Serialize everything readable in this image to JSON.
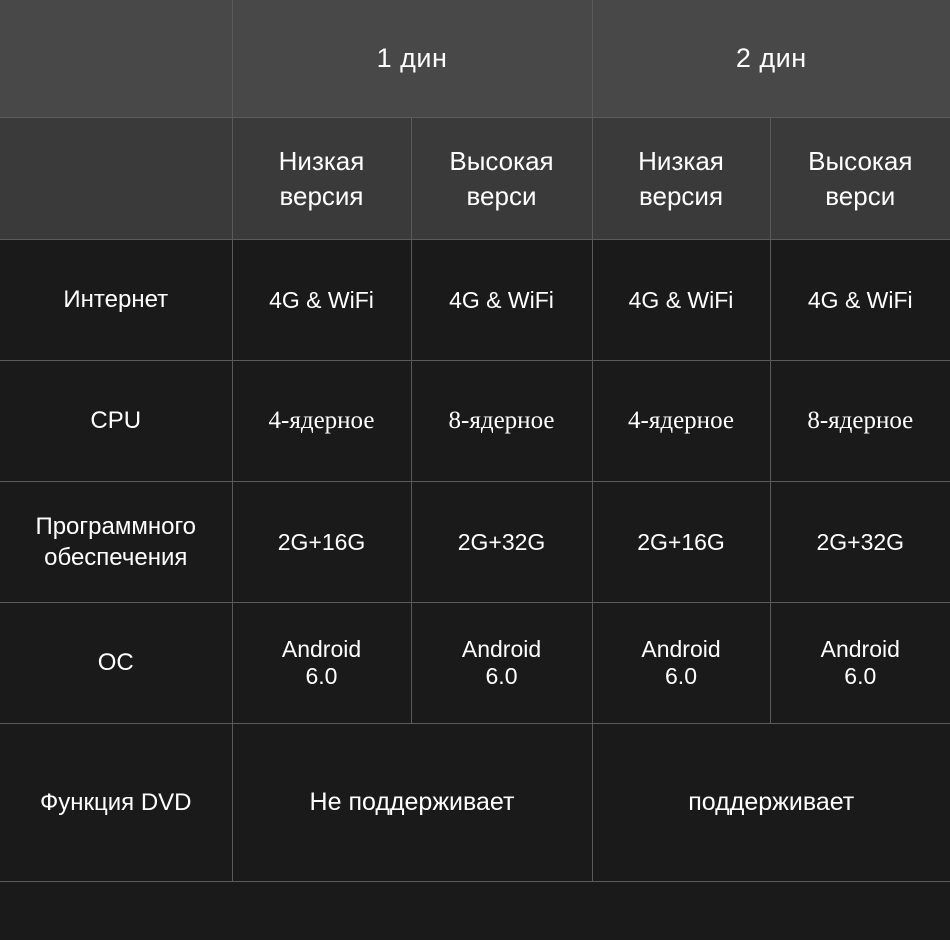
{
  "theme": {
    "background": "#1a1a1a",
    "header_group_bg": "#484848",
    "header_version_bg": "#3a3a3a",
    "grid_line": "#5a5a5a",
    "text": "#ffffff",
    "highlight": "#eec32c"
  },
  "table": {
    "corner_label": "",
    "groups": [
      {
        "label": "1 дин",
        "span": 2
      },
      {
        "label": "2 дин",
        "span": 2
      }
    ],
    "versions": [
      {
        "label": "Низкая версия",
        "line1": "Низкая",
        "line2": "версия",
        "highlight": false
      },
      {
        "label": "Высокая верси",
        "line1": "Высокая",
        "line2": "верси",
        "highlight": true
      },
      {
        "label": "Низкая версия",
        "line1": "Низкая",
        "line2": "версия",
        "highlight": false
      },
      {
        "label": "Высокая верси",
        "line1": "Высокая",
        "line2": "верси",
        "highlight": true
      }
    ],
    "rows": [
      {
        "label": "Интернет",
        "values": [
          "4G & WiFi",
          "4G & WiFi",
          "4G & WiFi",
          "4G & WiFi"
        ]
      },
      {
        "label": "CPU",
        "values": [
          "4-ядерное",
          "8-ядерное",
          "4-ядерное",
          "8-ядерное"
        ]
      },
      {
        "label": "Программного обеспечения",
        "label_line1": "Программного",
        "label_line2": "обеспечения",
        "values": [
          "2G+16G",
          "2G+32G",
          "2G+16G",
          "2G+32G"
        ]
      },
      {
        "label": "ОС",
        "values": [
          "Android 6.0",
          "Android 6.0",
          "Android 6.0",
          "Android 6.0"
        ],
        "value_line1": "Android",
        "value_line2": "6.0"
      }
    ],
    "dvd_row": {
      "label": "Функция DVD",
      "din1_value": "Не поддерживает",
      "din2_value": "поддерживает"
    }
  }
}
